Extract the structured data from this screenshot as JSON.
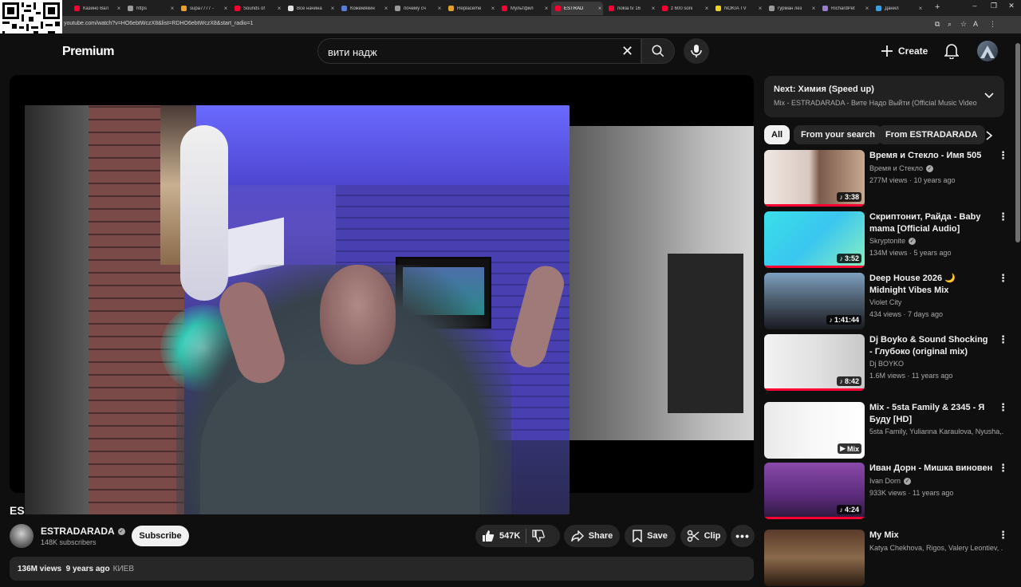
{
  "browser": {
    "tabs": [
      {
        "label": "Казино Вал",
        "color": "#ff0033"
      },
      {
        "label": "https",
        "color": "#9a9a9a"
      },
      {
        "label": "supa7777 - ",
        "color": "#f0a020"
      },
      {
        "label": "Sounds of ",
        "color": "#ff0033"
      },
      {
        "label": "Все начина",
        "color": "#e0e0e0"
      },
      {
        "label": "Кожемякин",
        "color": "#5b7bd5"
      },
      {
        "label": "почему сч",
        "color": "#9a9a9a"
      },
      {
        "label": "Replaceme",
        "color": "#e0a030"
      },
      {
        "label": "Мультфил",
        "color": "#ff0033"
      },
      {
        "label": "ESTRAD",
        "color": "#ff0033"
      },
      {
        "label": "nokia tv 16",
        "color": "#ff0033"
      },
      {
        "label": "z 600 soni",
        "color": "#ff0033"
      },
      {
        "label": "NOKIA TV",
        "color": "#f0d020"
      },
      {
        "label": "гурман лез",
        "color": "#9a9a9a"
      },
      {
        "label": "RichardPet",
        "color": "#9a7ad5"
      },
      {
        "label": "Данил",
        "color": "#3aa0e0"
      }
    ],
    "active_tab_index": 9,
    "url": "youtube.com/watch?v=HO6ebtWczX8&list=RDHO6ebtWczX8&start_radio=1",
    "window_controls": {
      "minimize": "–",
      "restore": "❐",
      "close": "✕"
    },
    "new_tab": "+"
  },
  "header": {
    "logo_text": "Premium",
    "search_value": "вити надж",
    "create_label": "Create"
  },
  "video": {
    "title": "ES",
    "channel_name": "ESTRADARADA",
    "subscribers": "148K subscribers",
    "subscribe_label": "Subscribe",
    "likes": "547K",
    "share_label": "Share",
    "save_label": "Save",
    "clip_label": "Clip",
    "views": "136M views",
    "age": "9 years ago",
    "tag": "КИЕВ"
  },
  "next": {
    "label": "Next: Химия (Speed up)",
    "sub": "Mix - ESTRADARADA - Вите Надо Выйти (Official Music Video"
  },
  "chips": [
    "All",
    "From your search",
    "From ESTRADARADA"
  ],
  "recommendations": [
    {
      "title": "Время и Стекло - Имя 505",
      "channel": "Время и Стекло",
      "verified": true,
      "meta": "277M views · 10 years ago",
      "duration": "3:38",
      "thumb": "t1",
      "progress": 1.0
    },
    {
      "title": "Скриптонит, Райда - Baby mama [Official Audio]",
      "channel": "Skryptonite",
      "verified": true,
      "meta": "134M views · 5 years ago",
      "duration": "3:52",
      "thumb": "t2",
      "progress": 1.0
    },
    {
      "title": "Deep House 2026 🌙 Midnight Vibes Mix",
      "channel": "Violet City",
      "verified": false,
      "meta": "434 views · 7 days ago",
      "duration": "1:41:44",
      "thumb": "t3",
      "progress": 0
    },
    {
      "title": "Dj Boyko & Sound Shocking - Глубоко (original mix)",
      "channel": "Dj BOYKO",
      "verified": false,
      "meta": "1.6M views · 11 years ago",
      "duration": "8:42",
      "thumb": "t4",
      "progress": 1.0
    },
    {
      "title": "Mix - 5sta Family & 2345 - Я Буду [HD]",
      "channel": "5sta Family, Yulianna Karaulova, Nyusha,...",
      "verified": false,
      "meta": "",
      "duration": "Mix",
      "thumb": "t5",
      "progress": 0
    },
    {
      "title": "Иван Дорн - Мишка виновен",
      "channel": "Ivan Dorn",
      "verified": true,
      "meta": "933K views · 11 years ago",
      "duration": "4:24",
      "thumb": "t6",
      "progress": 1.0
    },
    {
      "title": "My Mix",
      "channel": "Katya Chekhova, Rigos, Valery Leontiev, ...",
      "verified": false,
      "meta": "",
      "duration": "",
      "thumb": "t7",
      "progress": 0
    }
  ],
  "colors": {
    "accent": "#ff0033",
    "background": "#0f0f0f",
    "surface": "#272727"
  }
}
